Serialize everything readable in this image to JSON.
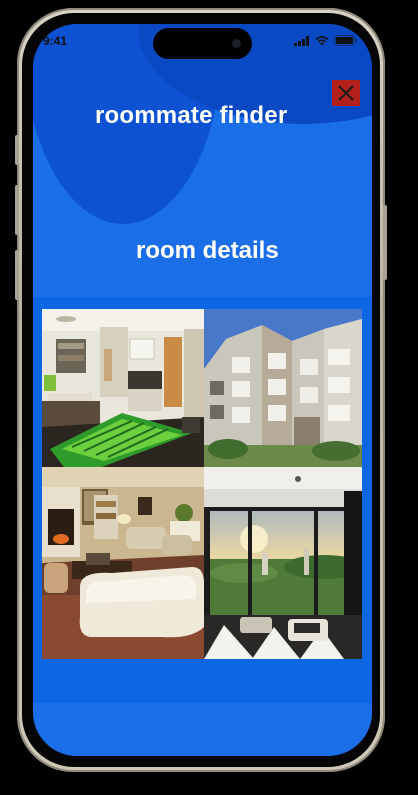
{
  "status_bar": {
    "time": "9:41",
    "icons": [
      "signal-icon",
      "wifi-icon",
      "battery-icon"
    ]
  },
  "header": {
    "app_title": "roommate finder",
    "close_icon": "close-icon"
  },
  "room": {
    "section_title": "room details",
    "photos": [
      {
        "name": "studio-interior-photo"
      },
      {
        "name": "apartment-building-photo"
      },
      {
        "name": "living-room-photo"
      },
      {
        "name": "city-view-lounge-photo"
      }
    ]
  },
  "colors": {
    "background": "#1a6ee8",
    "blob": "#0c52d2",
    "close_button": "#b3201b",
    "text": "#ffffff"
  }
}
